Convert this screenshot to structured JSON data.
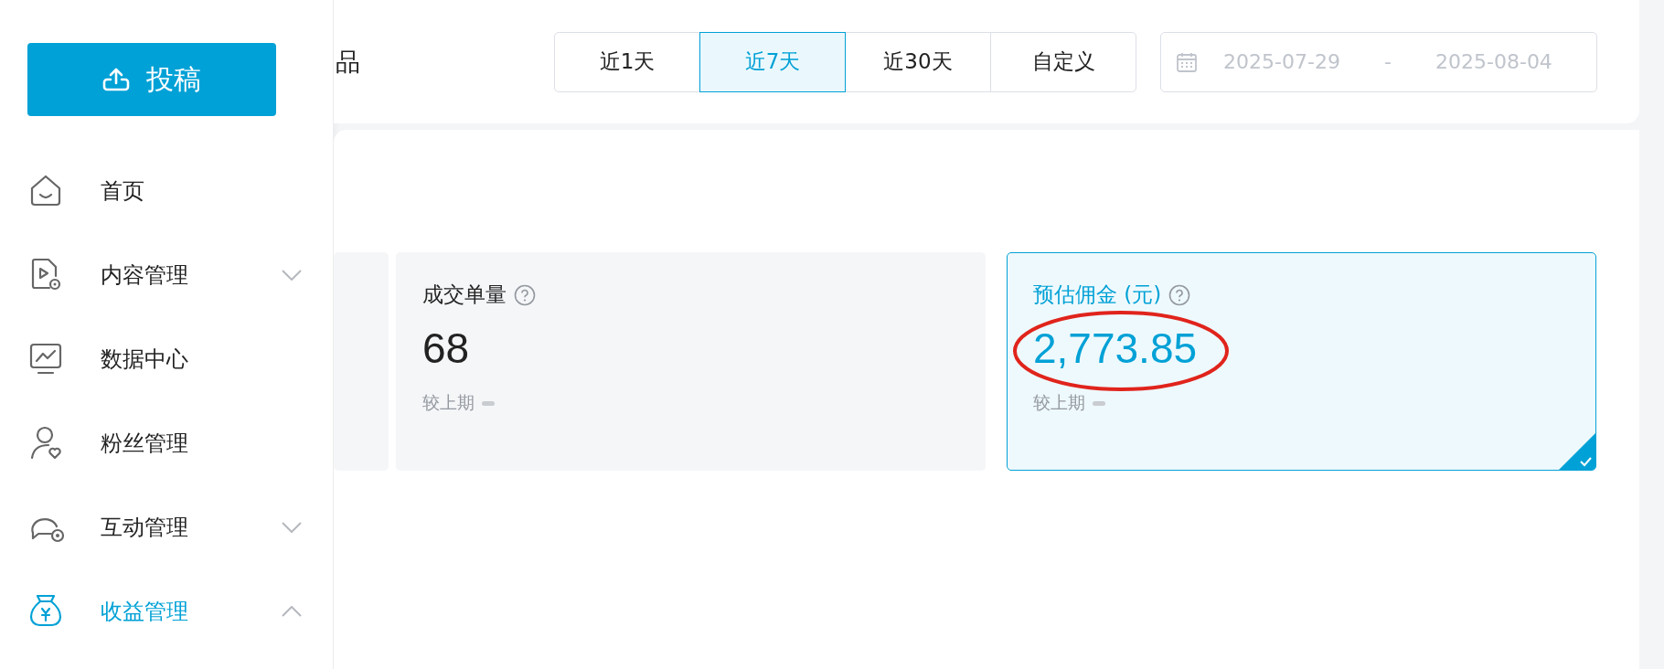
{
  "sidebar": {
    "upload_button": "投稿",
    "items": [
      {
        "kind": "home",
        "label": "首页",
        "selected": false
      },
      {
        "kind": "content",
        "label": "内容管理",
        "selected": false,
        "expanded": false
      },
      {
        "kind": "data",
        "label": "数据中心",
        "selected": false
      },
      {
        "kind": "fans",
        "label": "粉丝管理",
        "selected": false
      },
      {
        "kind": "interact",
        "label": "互动管理",
        "selected": false,
        "expanded": false
      },
      {
        "kind": "income",
        "label": "收益管理",
        "selected": true,
        "expanded": true
      }
    ]
  },
  "header": {
    "title": "品",
    "ranges": [
      {
        "label": "近1天",
        "selected": false
      },
      {
        "label": "近7天",
        "selected": true
      },
      {
        "label": "近30天",
        "selected": false
      },
      {
        "label": "自定义",
        "selected": false
      }
    ],
    "date_range": {
      "start_placeholder": "2025-07-29",
      "separator": "-",
      "end_placeholder": "2025-08-04"
    }
  },
  "cards": [
    {
      "selected": false
    },
    {
      "title": "成交单量",
      "value": "68",
      "compare": "较上期",
      "selected": false,
      "circled": false
    },
    {
      "title": "预估佣金 (元)",
      "value": "2,773.85",
      "compare": "较上期",
      "selected": true,
      "circled": true
    }
  ]
}
